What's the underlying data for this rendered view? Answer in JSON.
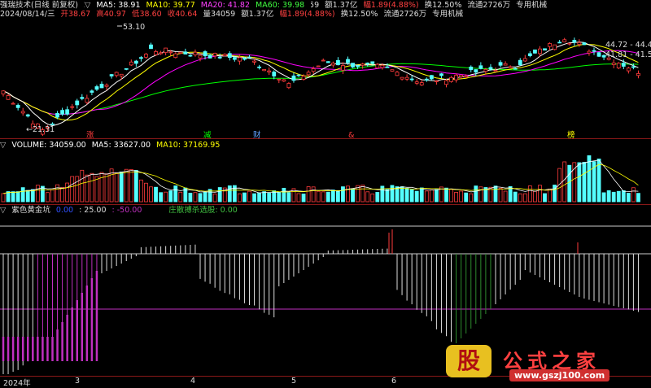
{
  "main_header": {
    "title": "强瑞技术(日线 前复权)",
    "date": "2024/08/14/三",
    "open": "开38.67",
    "high": "高40.97",
    "low": "低38.60",
    "close": "收40.64",
    "volume": "量34059",
    "amount": "额1.37亿",
    "change": "幅1.89(4.88%)",
    "turnover": "换12.50%",
    "float": "流通2726万",
    "tag": "专用机械",
    "ma5": "MA5: 38.91",
    "ma10": "MA10: 39.77",
    "ma20": "MA20: 41.82",
    "ma60": "MA60: 39.98"
  },
  "price_labels": {
    "high_mark": "53.10",
    "low_mark": "21.31",
    "right_top": "44.72 - 44.46",
    "right_mid": "41.81 - 41.50"
  },
  "signals": {
    "s1": "涨",
    "s2": "减",
    "s3": "财",
    "s4": "&",
    "s5": "榜"
  },
  "volume_header": {
    "name": "VOLUME: 34059.00",
    "ma5": "MA5: 33627.00",
    "ma10": "MA10: 37169.95"
  },
  "ind_header": {
    "name": "紫色黄金坑",
    "v1": "0.00",
    "v2": ": 25.00",
    "v3": ": -50.00",
    "v4": "庄散搏杀选股: 0.00"
  },
  "xaxis": {
    "year": "2024年",
    "m3": "3",
    "m4": "4",
    "m5": "5",
    "m6": "6"
  },
  "watermark": {
    "logo": "股",
    "brand": "公式之家",
    "url": "www.gszj100.com"
  },
  "colors": {
    "up": "#ff3c3c",
    "down": "#54ffff",
    "ma5": "#ffffff",
    "ma10": "#ffff00",
    "ma20": "#ff00ff",
    "ma60": "#00ff00",
    "purple": "#c030c0",
    "green_bar": "#2e8b2e"
  }
}
